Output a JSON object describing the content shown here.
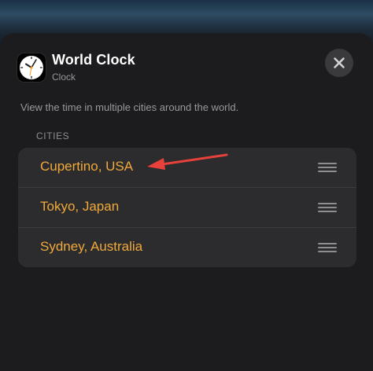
{
  "widget": {
    "title": "World Clock",
    "subtitle": "Clock",
    "description": "View the time in multiple cities around the world.",
    "close_icon": "close-x-icon",
    "app_icon": "clock-face-icon"
  },
  "cities_section": {
    "header": "CITIES",
    "items": [
      {
        "label": "Cupertino, USA",
        "handle_icon": "drag-handle-icon"
      },
      {
        "label": "Tokyo, Japan",
        "handle_icon": "drag-handle-icon"
      },
      {
        "label": "Sydney, Australia",
        "handle_icon": "drag-handle-icon"
      }
    ]
  },
  "colors": {
    "accent": "#f0a93a",
    "sheet_background": "#1c1c1e",
    "list_background": "#2c2c2e",
    "annotation_arrow": "#e8413c"
  },
  "annotation": {
    "type": "arrow",
    "points_to": "cities_section.items.0"
  }
}
